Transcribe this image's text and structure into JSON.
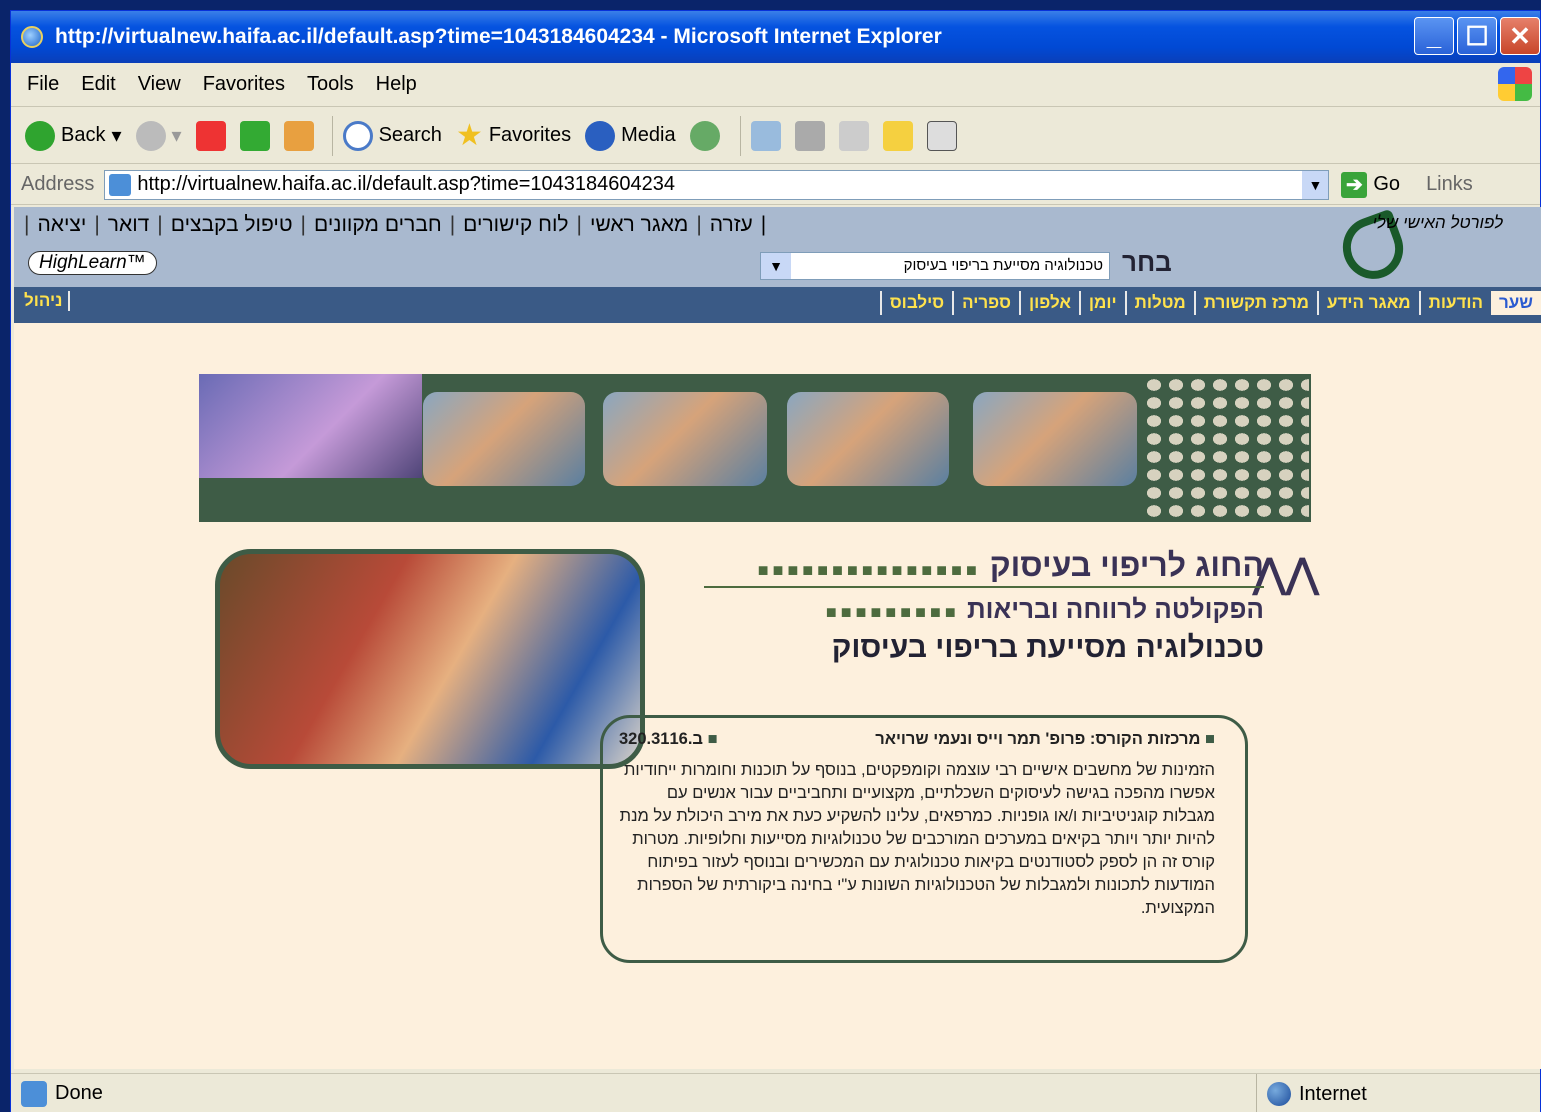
{
  "window": {
    "title": "http://virtualnew.haifa.ac.il/default.asp?time=1043184604234 - Microsoft Internet Explorer"
  },
  "menu": [
    "File",
    "Edit",
    "View",
    "Favorites",
    "Tools",
    "Help"
  ],
  "toolbar": {
    "back": "Back",
    "search": "Search",
    "favorites": "Favorites",
    "media": "Media"
  },
  "address": {
    "label": "Address",
    "url": "http://virtualnew.haifa.ac.il/default.asp?time=1043184604234",
    "go": "Go",
    "links": "Links"
  },
  "site": {
    "topnav": [
      "עזרה",
      "מאגר ראשי",
      "לוח קישורים",
      "חברים מקוונים",
      "טיפול בקבצים",
      "דואר",
      "יציאה"
    ],
    "highlearn": "HighLearn™",
    "logo_text": "לפורטל האישי שלי",
    "course_select": "טכנולוגיה מסייעת בריפוי בעיסוק",
    "select_label": "בחר",
    "tabs": [
      "שער",
      "הודעות",
      "מאגר הידע",
      "מרכז תקשורת",
      "מטלות",
      "יומן",
      "אלפון",
      "ספריה",
      "סילבוס"
    ],
    "admin_tab": "ניהול"
  },
  "page": {
    "dept": "החוג לריפוי בעיסוק",
    "faculty": "הפקולטה לרווחה ובריאות",
    "course": "טכנולוגיה מסייעת בריפוי בעיסוק",
    "coordinators": "מרכזות הקורס: פרופ' תמר וייס ונעמי שרויאר",
    "course_code": "ב.320.3116",
    "description": "הזמינות של מחשבים אישיים רבי עוצמה וקומפקטים, בנוסף על תוכנות וחומרות ייחודיות אפשרו מהפכה בגישה לעיסוקים השכלתיים, מקצועיים ותחביביים עבור אנשים עם מגבלות קוגניטיביות ו/או גופניות. כמרפאים, עלינו להשקיע כעת את מירב היכולת על מנת להיות יותר ויותר בקיאים במערכים המורכבים של טכנולוגיות מסייעות וחלופיות. מטרות קורס זה הן לספק לסטודנטים בקיאות טכנולוגית עם המכשירים ובנוסף לעזור בפיתוח המודעות לתכונות ולמגבלות של הטכנולוגיות השונות ע\"י בחינה ביקורתית של הספרות המקצועית."
  },
  "status": {
    "text": "Done",
    "zone": "Internet"
  }
}
